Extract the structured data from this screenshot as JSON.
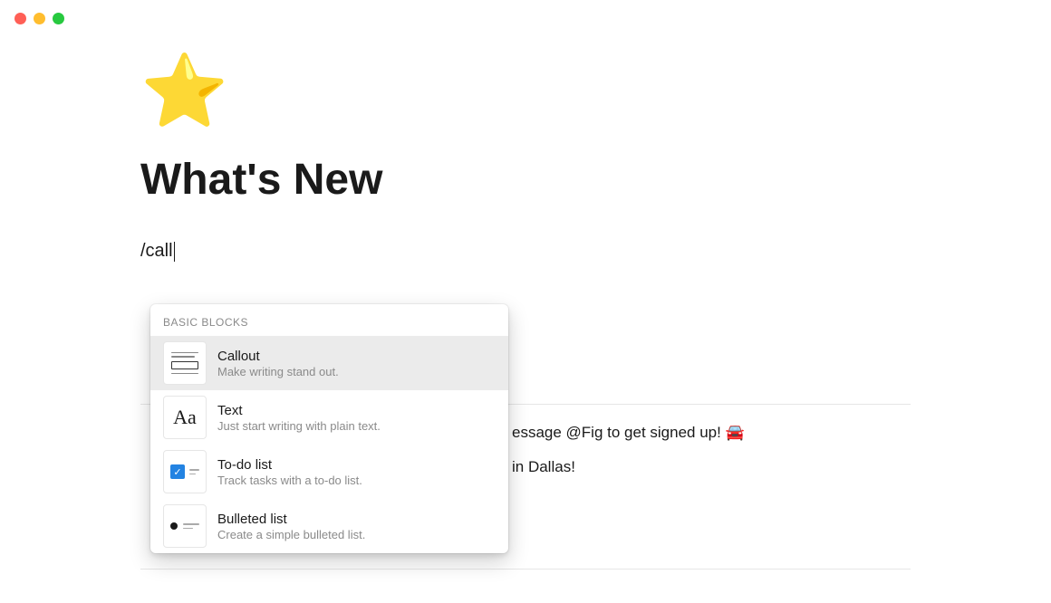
{
  "page": {
    "icon": "⭐",
    "title": "What's New",
    "slash_input": "/call"
  },
  "menu": {
    "header": "BASIC BLOCKS",
    "items": [
      {
        "title": "Callout",
        "desc": "Make writing stand out.",
        "icon": "callout",
        "selected": true
      },
      {
        "title": "Text",
        "desc": "Just start writing with plain text.",
        "icon": "text",
        "selected": false
      },
      {
        "title": "To-do list",
        "desc": "Track tasks with a to-do list.",
        "icon": "todo",
        "selected": false
      },
      {
        "title": "Bulleted list",
        "desc": "Create a simple bulleted list.",
        "icon": "bullet",
        "selected": false
      }
    ]
  },
  "background": {
    "line1_suffix": "essage @Fig to get signed up! 🚘",
    "line2_suffix": "in Dallas!"
  }
}
